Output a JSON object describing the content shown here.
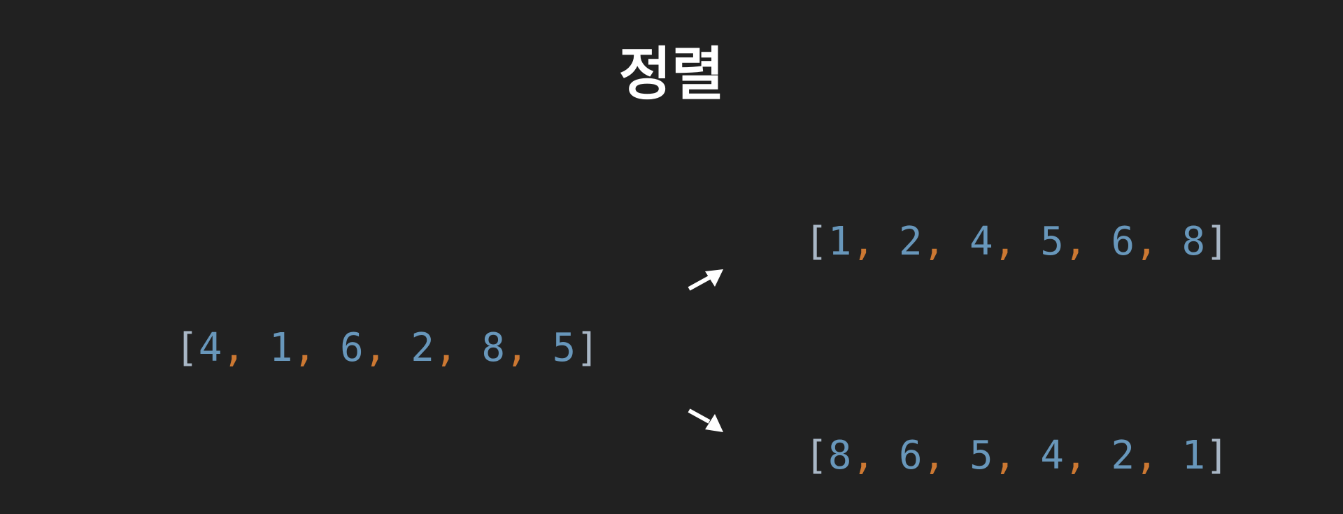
{
  "title": "정렬",
  "input_array": {
    "open": "[",
    "values": [
      "4",
      "1",
      "6",
      "2",
      "8",
      "5"
    ],
    "close": "]"
  },
  "ascending_array": {
    "open": "[",
    "values": [
      "1",
      "2",
      "4",
      "5",
      "6",
      "8"
    ],
    "close": "]"
  },
  "descending_array": {
    "open": "[",
    "values": [
      "8",
      "6",
      "5",
      "4",
      "2",
      "1"
    ],
    "close": "]"
  },
  "colors": {
    "background": "#212121",
    "title": "#ffffff",
    "bracket": "#a9b7c6",
    "number": "#6897bb",
    "comma": "#cc7832",
    "arrow": "#ffffff"
  },
  "icons": {
    "arrow_up": "arrow-up-right-icon",
    "arrow_down": "arrow-down-right-icon"
  }
}
